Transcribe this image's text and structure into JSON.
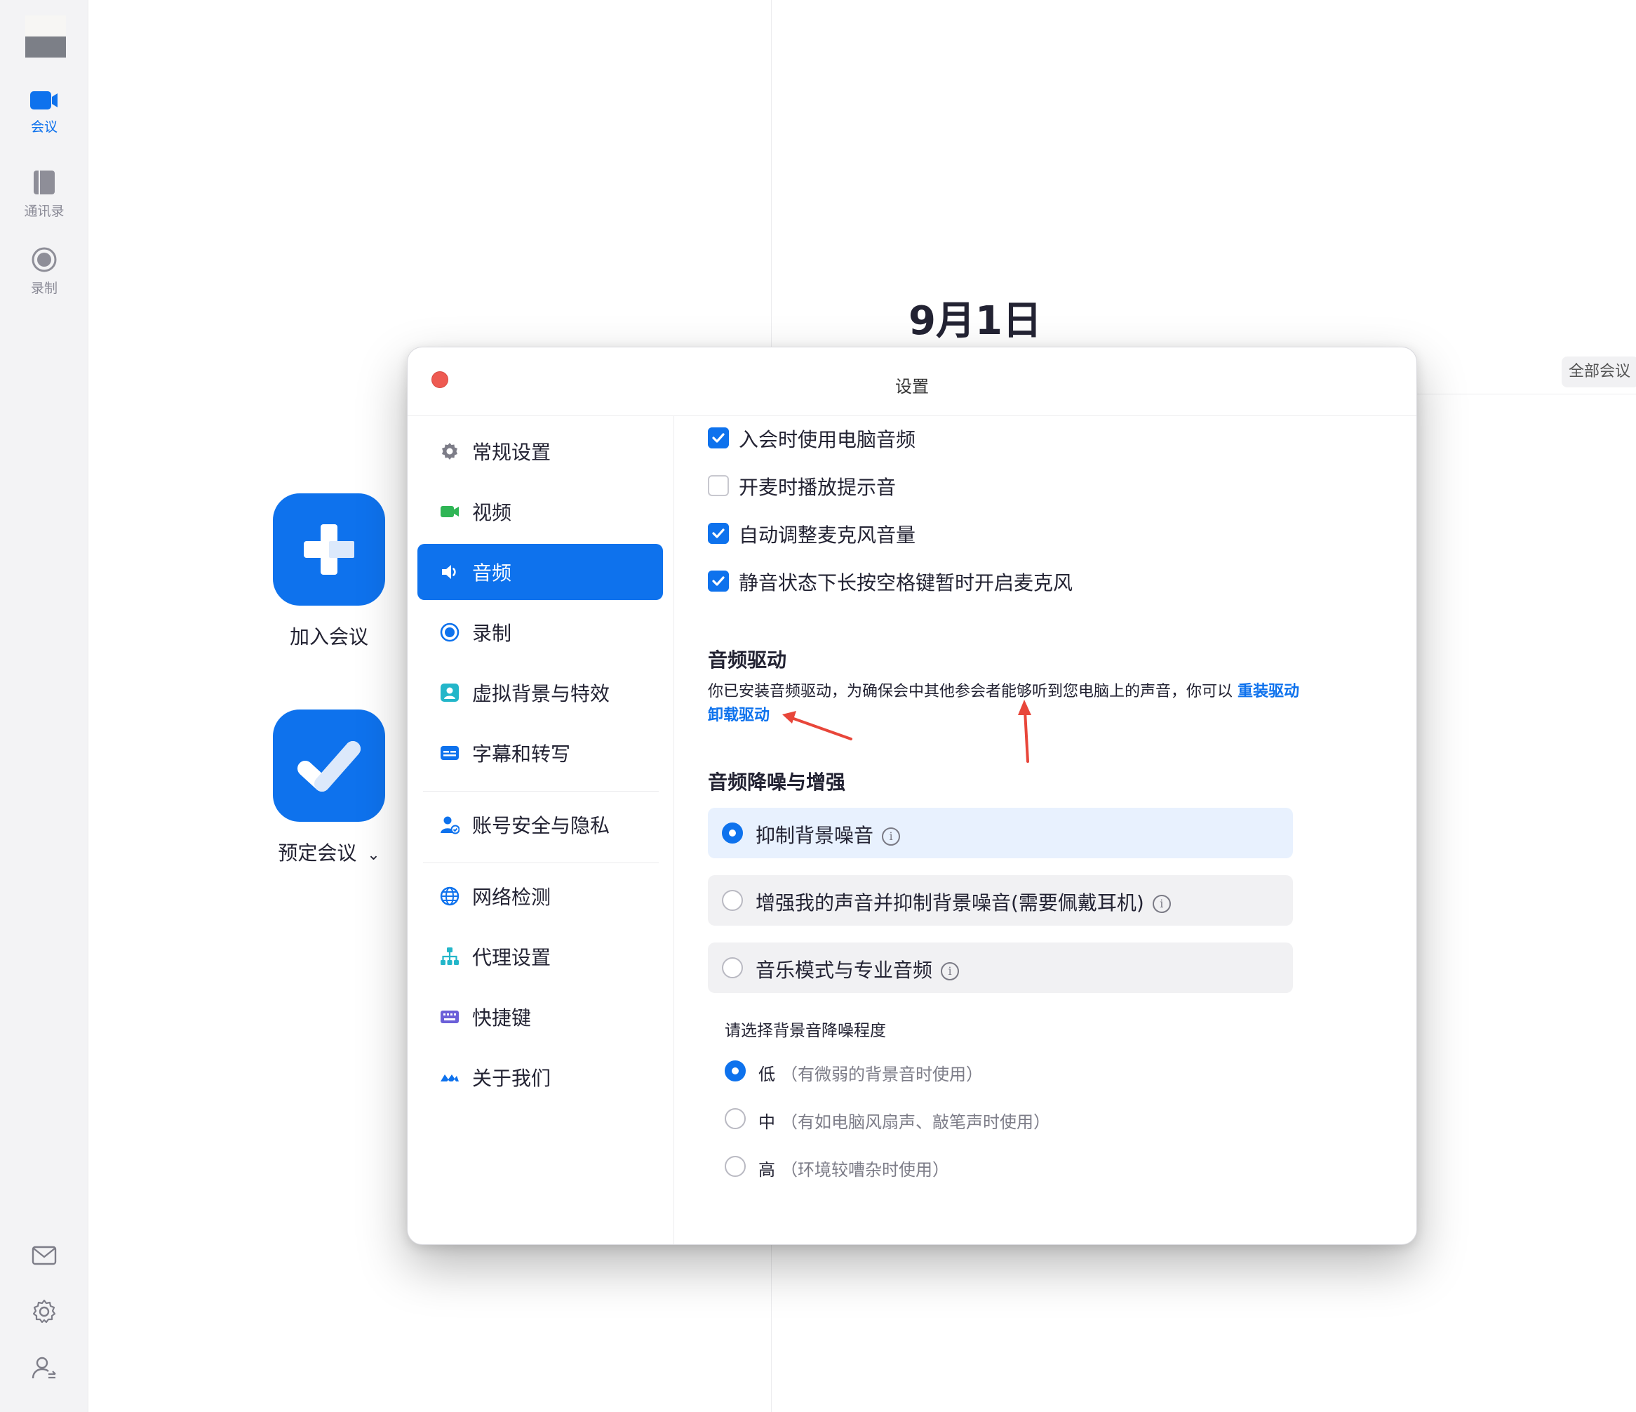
{
  "rail": {
    "items": [
      {
        "label": "会议",
        "icon": "video-camera-icon",
        "active": true
      },
      {
        "label": "通讯录",
        "icon": "contacts-book-icon",
        "active": false
      },
      {
        "label": "录制",
        "icon": "record-icon",
        "active": false
      }
    ],
    "bottom_icons": [
      "mail-icon",
      "settings-gear-icon",
      "profile-switch-icon"
    ]
  },
  "main": {
    "date_title": "9月1日",
    "all_meetings_label": "全部会议",
    "join_label": "加入会议",
    "schedule_label": "预定会议",
    "schedule_chevron": "⌄"
  },
  "dialog": {
    "title": "设置",
    "nav": [
      {
        "label": "常规设置",
        "icon": "gear-icon",
        "active": false
      },
      {
        "label": "视频",
        "icon": "video-icon",
        "active": false
      },
      {
        "label": "音频",
        "icon": "speaker-icon",
        "active": true
      },
      {
        "label": "录制",
        "icon": "record-icon",
        "active": false
      },
      {
        "label": "虚拟背景与特效",
        "icon": "virtual-background-icon",
        "active": false
      },
      {
        "label": "字幕和转写",
        "icon": "captions-icon",
        "active": false
      },
      {
        "label": "账号安全与隐私",
        "icon": "account-security-icon",
        "active": false
      },
      {
        "label": "网络检测",
        "icon": "globe-icon",
        "active": false
      },
      {
        "label": "代理设置",
        "icon": "proxy-network-icon",
        "active": false
      },
      {
        "label": "快捷键",
        "icon": "keyboard-icon",
        "active": false
      },
      {
        "label": "关于我们",
        "icon": "about-logo-icon",
        "active": false
      }
    ],
    "checkboxes": [
      {
        "label": "入会时使用电脑音频",
        "checked": true
      },
      {
        "label": "开麦时播放提示音",
        "checked": false
      },
      {
        "label": "自动调整麦克风音量",
        "checked": true
      },
      {
        "label": "静音状态下长按空格键暂时开启麦克风",
        "checked": true
      }
    ],
    "driver": {
      "title": "音频驱动",
      "text": "你已安装音频驱动，为确保会中其他参会者能够听到您电脑上的声音，你可以 ",
      "reinstall_link": "重装驱动",
      "uninstall_link": "卸载驱动"
    },
    "enhance": {
      "title": "音频降噪与增强",
      "options": [
        {
          "label": "抑制背景噪音",
          "selected": true
        },
        {
          "label": "增强我的声音并抑制背景噪音(需要佩戴耳机)",
          "selected": false
        },
        {
          "label": "音乐模式与专业音频",
          "selected": false
        }
      ],
      "info_glyph": "i"
    },
    "level": {
      "title": "请选择背景音降噪程度",
      "options": [
        {
          "label": "低",
          "hint": "（有微弱的背景音时使用）",
          "selected": true
        },
        {
          "label": "中",
          "hint": "（有如电脑风扇声、敲笔声时使用）",
          "selected": false
        },
        {
          "label": "高",
          "hint": "（环境较嘈杂时使用）",
          "selected": false
        }
      ]
    }
  },
  "colors": {
    "accent": "#0e72ed",
    "close_button": "#ee5a52",
    "annotation_arrow": "#e8463a"
  }
}
